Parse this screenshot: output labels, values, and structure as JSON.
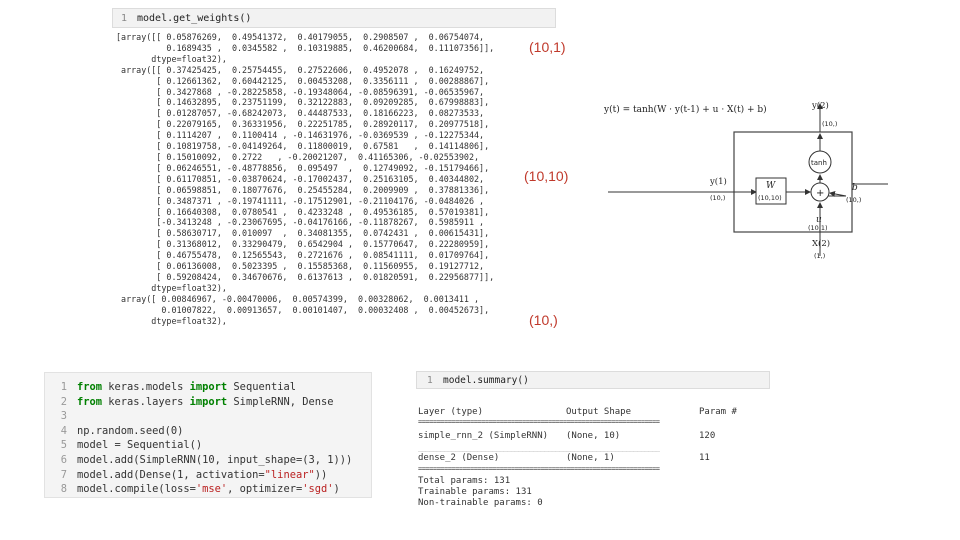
{
  "top_cell": {
    "line_number": "1",
    "code": "model.get_weights()"
  },
  "weights_output": [
    "[array([[ 0.05876269,  0.49541372,  0.40179055,  0.2908507 ,  0.06754074,",
    "          0.1689435 ,  0.0345582 ,  0.10319885,  0.46200684,  0.11107356]],",
    "       dtype=float32),",
    " array([[ 0.37425425,  0.25754455,  0.27522606,  0.4952078 ,  0.16249752,",
    "        [ 0.12661362,  0.60442125,  0.00453208,  0.3356111 ,  0.00288867],",
    "        [ 0.3427868 , -0.28225858, -0.19348064, -0.08596391, -0.06535967,",
    "        [ 0.14632895,  0.23751199,  0.32122883,  0.09209285,  0.67998883],",
    "        [ 0.01287057, -0.68242073,  0.44487533,  0.18166223,  0.08273533,",
    "        [ 0.22079165,  0.36331956,  0.22251785,  0.28920117,  0.20977518],",
    "        [ 0.1114207 ,  0.1100414 , -0.14631976, -0.0369539 , -0.12275344,",
    "        [ 0.10819758, -0.04149264,  0.11800019,  0.67581   ,  0.14114806],",
    "        [ 0.15010092,  0.2722   , -0.20021207,  0.41165306, -0.02553902,",
    "        [ 0.06246551, -0.48778856,  0.095497  ,  0.12749092, -0.15179466],",
    "        [ 0.61170851, -0.03870624, -0.17002437,  0.25163105,  0.40344802,",
    "        [ 0.06598851,  0.18077676,  0.25455284,  0.2009909 ,  0.37881336],",
    "        [ 0.3487371 , -0.19741111, -0.17512901, -0.21104176, -0.0484026 ,",
    "        [ 0.16640308,  0.0780541 ,  0.4233248 ,  0.49536185,  0.57019381],",
    "        [-0.3413248 , -0.23067695, -0.04176166, -0.11878267,  0.5985911 ,",
    "        [ 0.58630717,  0.010097  ,  0.34081355,  0.0742431 ,  0.00615431],",
    "        [ 0.31368012,  0.33290479,  0.6542904 ,  0.15770647,  0.22280959],",
    "        [ 0.46755478,  0.12565543,  0.2721676 ,  0.08541111,  0.01709764],",
    "        [ 0.06136008,  0.5023395 ,  0.15585368,  0.11560955,  0.19127712,",
    "        [ 0.59208424,  0.34670676,  0.6137613 ,  0.01820591,  0.22956877]],",
    "       dtype=float32),",
    " array([ 0.00846967, -0.00470006,  0.00574399,  0.00328062,  0.0013411 ,",
    "         0.01007822,  0.00913657,  0.00101407,  0.00032408 ,  0.00452673],",
    "       dtype=float32),"
  ],
  "shape_labels": [
    "(10,1)",
    "(10,10)",
    "(10,)"
  ],
  "code_cell": {
    "lines": [
      {
        "num": "1",
        "parts": [
          {
            "t": "from",
            "c": "kw"
          },
          {
            "t": " keras.models ",
            "c": ""
          },
          {
            "t": "import",
            "c": "kw"
          },
          {
            "t": " Sequential",
            "c": ""
          }
        ]
      },
      {
        "num": "2",
        "parts": [
          {
            "t": "from",
            "c": "kw"
          },
          {
            "t": " keras.layers ",
            "c": ""
          },
          {
            "t": "import",
            "c": "kw"
          },
          {
            "t": " SimpleRNN, Dense",
            "c": ""
          }
        ]
      },
      {
        "num": "3",
        "parts": []
      },
      {
        "num": "4",
        "parts": [
          {
            "t": "np.random.seed(0)",
            "c": ""
          }
        ]
      },
      {
        "num": "5",
        "parts": [
          {
            "t": "model = Sequential()",
            "c": ""
          }
        ]
      },
      {
        "num": "6",
        "parts": [
          {
            "t": "model.add(SimpleRNN(10, input_shape=(3, 1)))",
            "c": ""
          }
        ]
      },
      {
        "num": "7",
        "parts": [
          {
            "t": "model.add(Dense(1, activation=",
            "c": ""
          },
          {
            "t": "\"linear\"",
            "c": "str"
          },
          {
            "t": "))",
            "c": ""
          }
        ]
      },
      {
        "num": "8",
        "parts": [
          {
            "t": "model.compile(loss=",
            "c": ""
          },
          {
            "t": "'mse'",
            "c": "str"
          },
          {
            "t": ", optimizer=",
            "c": ""
          },
          {
            "t": "'sgd'",
            "c": "str"
          },
          {
            "t": ")",
            "c": ""
          }
        ]
      }
    ]
  },
  "summary_cell": {
    "line_number": "1",
    "code": "model.summary()",
    "header": {
      "layer": "Layer (type)",
      "shape": "Output Shape",
      "params": "Param #"
    },
    "separator": "=================================================================",
    "rows": [
      {
        "layer": "simple_rnn_2 (SimpleRNN)",
        "shape": "(None, 10)",
        "params": "120"
      },
      {
        "layer": "dense_2 (Dense)",
        "shape": "(None, 1)",
        "params": "11"
      }
    ],
    "totals": [
      "Total params: 131",
      "Trainable params: 131",
      "Non-trainable params: 0"
    ]
  },
  "diagram": {
    "equation": "y(t) = tanh(W · y(t-1) + u · X(t) + b)",
    "output_label": "y(2)",
    "output_shape": "(10,)",
    "tanh_label": "tanh",
    "input_label": "y(1)",
    "input_shape": "(10,)",
    "w_label": "W",
    "w_shape": "(10,10)",
    "u_label": "u",
    "u_shape": "(10,1)",
    "b_label": "b",
    "b_shape": "(10,)",
    "x_label": "X(2)",
    "x_shape": "(1,)"
  }
}
